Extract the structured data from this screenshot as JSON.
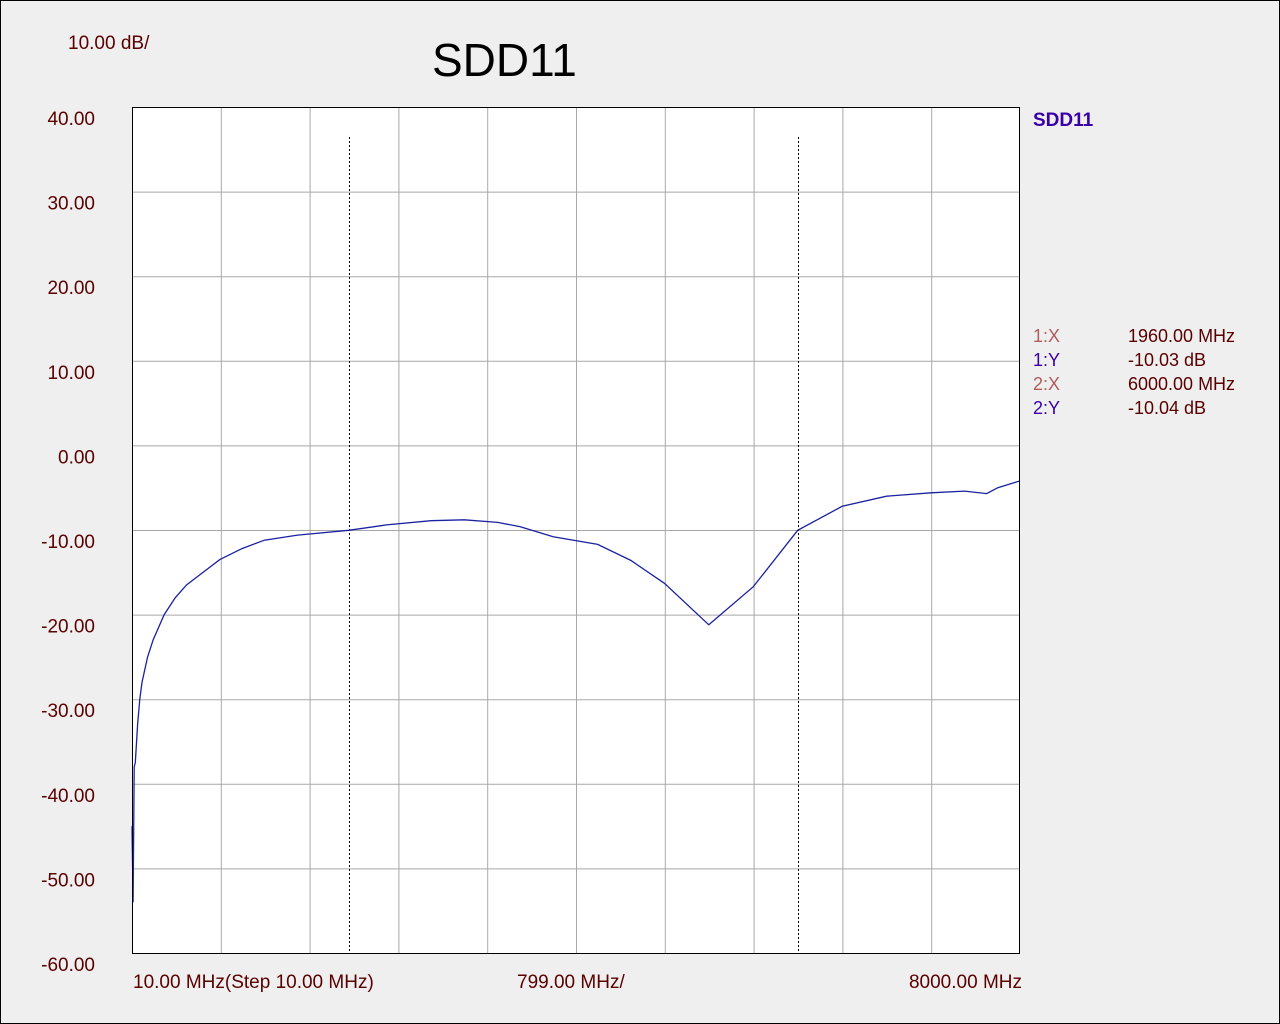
{
  "chart_data": {
    "type": "line",
    "title": "SDD11",
    "scale_label": "10.00 dB/",
    "legend": {
      "name": "SDD11",
      "color": "#3a00a8",
      "placement": "right"
    },
    "ylim": [
      -60,
      40
    ],
    "yticks": [
      "40.00",
      "30.00",
      "20.00",
      "10.00",
      "0.00",
      "-10.00",
      "-20.00",
      "-30.00",
      "-40.00",
      "-50.00",
      "-60.00"
    ],
    "xlim": [
      10,
      8000
    ],
    "x_labels": {
      "start": "10.00 MHz(Step 10.00 MHz)",
      "division": "799.00 MHz/",
      "stop": "8000.00 MHz"
    },
    "grid": true,
    "series": [
      {
        "name": "SDD11",
        "color": "#1a22a0",
        "x": [
          10,
          20,
          30,
          40,
          60,
          80,
          100,
          150,
          200,
          300,
          400,
          500,
          600,
          800,
          1000,
          1200,
          1500,
          1960,
          2300,
          2700,
          3000,
          3300,
          3500,
          3800,
          4200,
          4500,
          4800,
          5200,
          5600,
          6000,
          6400,
          6800,
          7200,
          7500,
          7700,
          7800,
          8000
        ],
        "y": [
          -45,
          -54,
          -38,
          -37.5,
          -33,
          -30,
          -28,
          -25,
          -23,
          -20,
          -18,
          -16.5,
          -15.5,
          -13.5,
          -12.2,
          -11.2,
          -10.6,
          -10.03,
          -9.4,
          -8.9,
          -8.8,
          -9.1,
          -9.6,
          -10.8,
          -11.7,
          -13.6,
          -16.3,
          -21.2,
          -16.7,
          -10.04,
          -7.2,
          -6,
          -5.6,
          -5.4,
          -5.7,
          -5,
          -4.2
        ]
      }
    ],
    "markers": [
      {
        "x_label": "1:X",
        "x_value": "1960.00 MHz",
        "y_label": "1:Y",
        "y_value": "-10.03 dB",
        "x": 1960
      },
      {
        "x_label": "2:X",
        "x_value": "6000.00 MHz",
        "y_label": "2:Y",
        "y_value": "-10.04 dB",
        "x": 6000
      }
    ],
    "colors": {
      "marker_x_label": "#b25c5c",
      "marker_y_label": "#3a00a8",
      "value_text": "#5a0000"
    }
  }
}
